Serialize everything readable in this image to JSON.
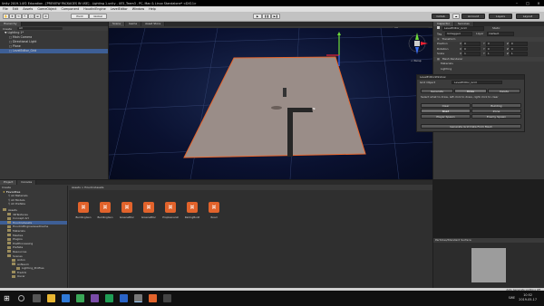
{
  "window": {
    "title": "Unity 2019.1.0f2 Education - [PREVIEW PACKAGES IN USE] - Lighting 1.unity - UE5_Team3 - PC, Mac & Linux Standalone* <DX11>"
  },
  "menu": [
    "File",
    "Edit",
    "Assets",
    "GameObject",
    "Component",
    "HoudiniEngine",
    "LevelEditor",
    "Window",
    "Help"
  ],
  "toolbar": {
    "pivot": "Pivot",
    "global": "Global",
    "collab": "Collab",
    "account": "Account",
    "layers": "Layers",
    "layout": "Layout"
  },
  "hierarchy": {
    "tab": "Hierarchy",
    "create": "Create",
    "search": "All",
    "items": [
      {
        "label": "Lighting 1*",
        "indent": 1,
        "sel": false
      },
      {
        "label": "Main Camera",
        "indent": 2,
        "sel": false
      },
      {
        "label": "Directional Light",
        "indent": 2,
        "sel": false
      },
      {
        "label": "Plane",
        "indent": 2,
        "sel": false
      },
      {
        "label": "LevelEditor_Grid",
        "indent": 2,
        "sel": true
      }
    ]
  },
  "scene": {
    "tabs": [
      "Scene",
      "Game",
      "Asset Store"
    ],
    "shaded": "Shaded",
    "mode": "2D",
    "gizmos": "Gizmos",
    "search": "All",
    "persp": "< Persp"
  },
  "inspector": {
    "tabs": [
      "Inspector",
      "Services"
    ],
    "object_name": "LevelEditor_Grid",
    "static": "Static",
    "tag_label": "Tag",
    "tag_value": "Untagged",
    "layer_label": "Layer",
    "layer_value": "Default",
    "transform": "Transform",
    "rows": [
      {
        "label": "Position",
        "x": "0",
        "y": "0",
        "z": "0"
      },
      {
        "label": "Rotation",
        "x": "0",
        "y": "0",
        "z": "0"
      },
      {
        "label": "Scale",
        "x": "1",
        "y": "1",
        "z": "1"
      }
    ],
    "mesh_renderer": "Mesh Renderer",
    "materials": "Materials",
    "lighting": "Lighting"
  },
  "editor_window": {
    "title": "LevelEditorWindow",
    "grid_object_label": "Grid Object",
    "grid_object_value": "LevelEditor_Grid",
    "modes": [
      "Generate",
      "Draw",
      "Delete"
    ],
    "active_mode": "Draw",
    "instruction": "Select what to draw, left click to draw, right click to clear",
    "brushes": [
      "Clear",
      "Building",
      "Road",
      "Zone",
      "Player Spawn",
      "Enemy Spawn"
    ],
    "active_brush": "Road",
    "generate_button": "Generate Grid Data From Mesh"
  },
  "project": {
    "tabs": [
      "Project",
      "Console"
    ],
    "create": "Create",
    "breadcrumb": "Assets > HoudiniAssets",
    "favorites": {
      "label": "Favorites",
      "items": [
        "All Materials",
        "All Models",
        "All Prefabs"
      ]
    },
    "folders": [
      {
        "label": "Assets",
        "indent": 0
      },
      {
        "label": "3DTextures",
        "indent": 1
      },
      {
        "label": "Concept Art",
        "indent": 1
      },
      {
        "label": "HoudiniAssets",
        "indent": 1
      },
      {
        "label": "HoudiniEngineAssetCache",
        "indent": 1
      },
      {
        "label": "Materials",
        "indent": 1
      },
      {
        "label": "Meshes",
        "indent": 1
      },
      {
        "label": "Plugins",
        "indent": 1
      },
      {
        "label": "PostProcessing",
        "indent": 1
      },
      {
        "label": "Prefabs",
        "indent": 1
      },
      {
        "label": "Resources",
        "indent": 1
      },
      {
        "label": "Scenes",
        "indent": 1
      },
      {
        "label": "Anton",
        "indent": 2
      },
      {
        "label": "AnNaum",
        "indent": 2
      },
      {
        "label": "Lighting_Profiles",
        "indent": 3
      },
      {
        "label": "Fredrik",
        "indent": 2
      },
      {
        "label": "Oscar",
        "indent": 2
      }
    ],
    "assets": [
      "BuildingGen",
      "BuildingGen",
      "GreeneBloc",
      "GreeneBloc",
      "PropGenerat",
      "RailingBuild",
      "Road"
    ]
  },
  "preview": {
    "title": "Particles/Standard Surface",
    "asset_bundle": "AssetBundle",
    "none": "None",
    "none2": "None"
  },
  "status": "Auto Generate Lighting Off",
  "taskbar": {
    "time": "10:52",
    "date": "2019-05-17",
    "lang": "SWE"
  }
}
